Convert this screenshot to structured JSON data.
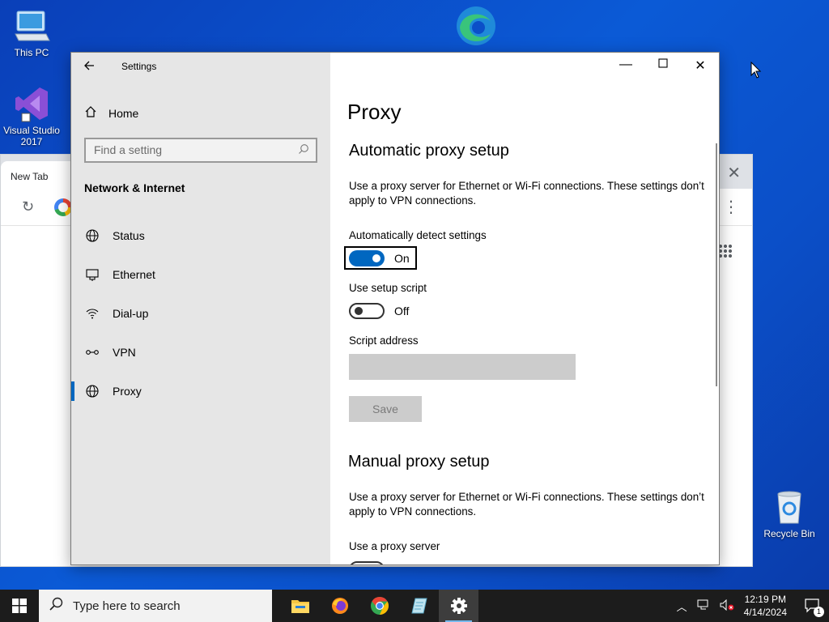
{
  "desktop": {
    "icons": [
      {
        "label": "This PC"
      },
      {
        "label_line1": "Visual Studio",
        "label_line2": "2017"
      },
      {
        "label": "Recycle Bin"
      }
    ]
  },
  "chrome": {
    "tab_title": "New Tab"
  },
  "settings": {
    "title": "Settings",
    "nav": {
      "home_label": "Home",
      "search_placeholder": "Find a setting",
      "section_title": "Network & Internet",
      "items": [
        {
          "label": "Status"
        },
        {
          "label": "Ethernet"
        },
        {
          "label": "Dial-up"
        },
        {
          "label": "VPN"
        },
        {
          "label": "Proxy"
        }
      ],
      "active_item": "Proxy"
    },
    "content": {
      "page_title": "Proxy",
      "auto": {
        "heading": "Automatic proxy setup",
        "description": "Use a proxy server for Ethernet or Wi-Fi connections. These settings don’t apply to VPN connections.",
        "detect_label": "Automatically detect settings",
        "detect_state": "On",
        "detect_on": true,
        "script_label": "Use setup script",
        "script_state": "Off",
        "script_on": false,
        "address_label": "Script address",
        "address_value": "",
        "save_label": "Save"
      },
      "manual": {
        "heading": "Manual proxy setup",
        "description": "Use a proxy server for Ethernet or Wi-Fi connections. These settings don’t apply to VPN connections.",
        "use_proxy_label": "Use a proxy server"
      }
    }
  },
  "taskbar": {
    "search_placeholder": "Type here to search",
    "time": "12:19 PM",
    "date": "4/14/2024",
    "notification_count": "1"
  },
  "colors": {
    "accent": "#0067c0",
    "nav_bg": "#e6e6e6",
    "taskbar_bg": "#1c1c1c"
  }
}
